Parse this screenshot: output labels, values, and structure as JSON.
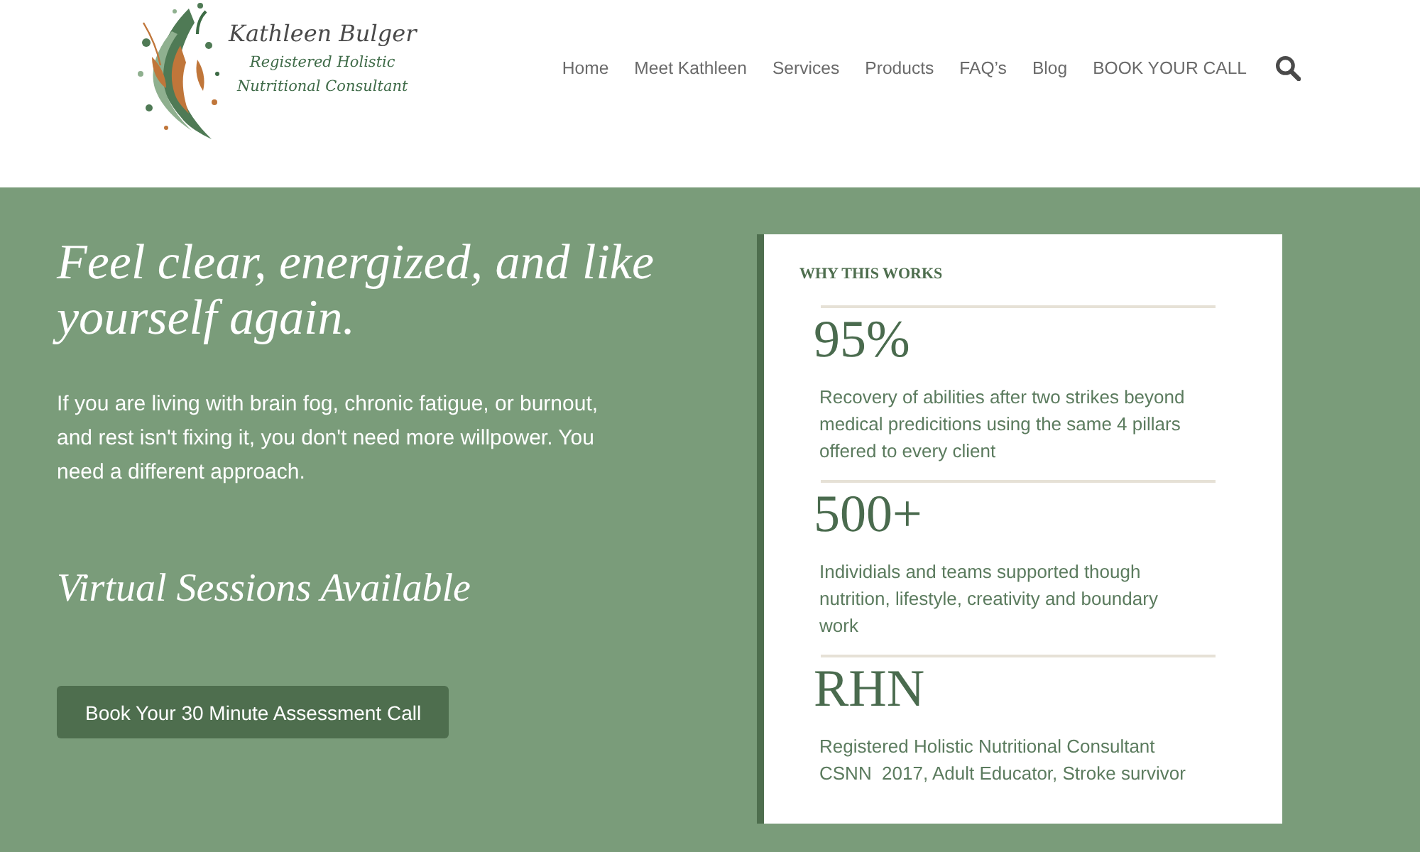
{
  "header": {
    "logo": {
      "name": "Kathleen Bulger",
      "tagline": "Registered Holistic\nNutritional Consultant"
    },
    "nav": [
      "Home",
      "Meet Kathleen",
      "Services",
      "Products",
      "FAQ’s",
      "Blog",
      "BOOK YOUR CALL"
    ]
  },
  "hero": {
    "heading": "Feel clear, energized, and like yourself again.",
    "intro": "If you are living with brain fog, chronic fatigue, or burnout, and rest isn't fixing it, you don't need more willpower. You need a different approach.",
    "subheading": "Virtual Sessions Available",
    "cta": "Book Your 30 Minute Assessment Call"
  },
  "card": {
    "title": "WHY THIS WORKS",
    "stats": [
      {
        "value": "95%",
        "description": "Recovery of abilities after two strikes beyond medical predicitions using the same 4 pillars offered to every client"
      },
      {
        "value": "500+",
        "description": "Individials and teams supported though nutrition, lifestyle, creativity and boundary work"
      },
      {
        "value": "RHN",
        "description": "Registered Holistic Nutritional Consultant\nCSNN  2017, Adult Educator, Stroke survivor"
      }
    ]
  }
}
